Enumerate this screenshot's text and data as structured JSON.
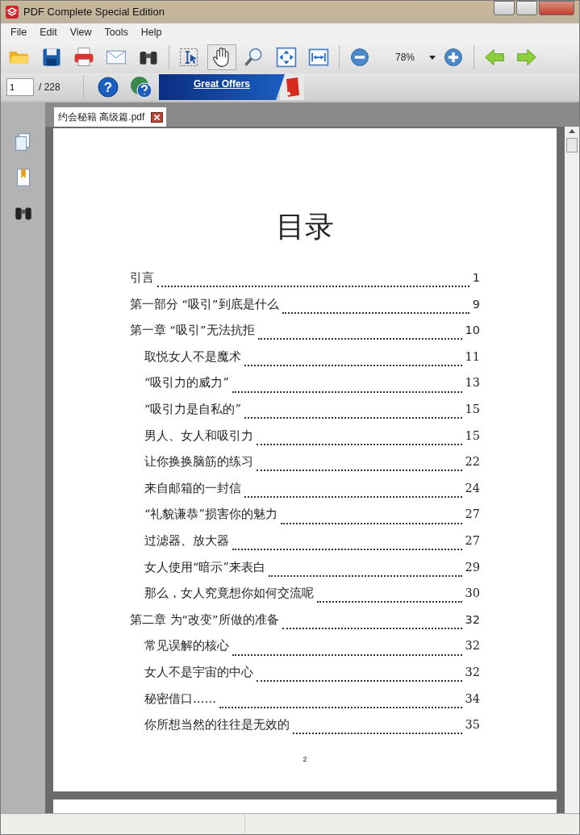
{
  "window": {
    "title": "PDF Complete Special Edition"
  },
  "menu": [
    "File",
    "Edit",
    "View",
    "Tools",
    "Help"
  ],
  "toolbar": [
    {
      "kind": "open",
      "selected": false
    },
    {
      "kind": "save",
      "selected": false
    },
    {
      "kind": "print",
      "selected": false
    },
    {
      "kind": "email",
      "selected": false
    },
    {
      "kind": "find",
      "selected": false
    },
    {
      "kind": "sep"
    },
    {
      "kind": "select",
      "selected": false
    },
    {
      "kind": "hand",
      "selected": true
    },
    {
      "kind": "magnify",
      "selected": false
    },
    {
      "kind": "fitpage",
      "selected": false
    },
    {
      "kind": "fitwidth",
      "selected": false
    },
    {
      "kind": "sep"
    },
    {
      "kind": "zoomout",
      "selected": false
    },
    {
      "kind": "zoom",
      "value": "78%"
    },
    {
      "kind": "zoomin",
      "selected": false
    },
    {
      "kind": "sep"
    },
    {
      "kind": "back",
      "selected": false
    },
    {
      "kind": "forward",
      "selected": false
    }
  ],
  "page_nav": {
    "value": "1",
    "total": "/ 228"
  },
  "help": {
    "glyph": "?"
  },
  "banner": {
    "text": "Great Offers"
  },
  "sidebar": [
    {
      "kind": "pages"
    },
    {
      "kind": "bookmarks"
    },
    {
      "kind": "search"
    }
  ],
  "tabs": [
    {
      "label": "约会秘籍 高级篇.pdf",
      "selected": true
    }
  ],
  "document": {
    "title": "目录",
    "page_number": "2",
    "toc": [
      {
        "kind": "chapter",
        "text": "引言",
        "page": "1"
      },
      {
        "kind": "chapter",
        "text": "第一部分 “吸引”到底是什么",
        "page": "9"
      },
      {
        "kind": "chapter",
        "text": "第一章 “吸引”无法抗拒",
        "page": "10"
      },
      {
        "kind": "section",
        "text": "取悦女人不是魔术",
        "page": "11"
      },
      {
        "kind": "section",
        "text": "“吸引力的威力”",
        "page": "13"
      },
      {
        "kind": "section",
        "text": "“吸引力是自私的”",
        "page": "15"
      },
      {
        "kind": "section",
        "text": "男人、女人和吸引力",
        "page": "15"
      },
      {
        "kind": "section",
        "text": "让你换换脑筋的练习",
        "page": "22"
      },
      {
        "kind": "section",
        "text": "来自邮箱的一封信",
        "page": "24"
      },
      {
        "kind": "section",
        "text": "“礼貌谦恭”损害你的魅力",
        "page": "27"
      },
      {
        "kind": "section",
        "text": "过滤器、放大器",
        "page": "27"
      },
      {
        "kind": "section",
        "text": "女人使用“暗示”来表白",
        "page": "29"
      },
      {
        "kind": "section",
        "text": "那么，女人究竟想你如何交流呢",
        "page": "30"
      },
      {
        "kind": "chapter",
        "text": "第二章 为“改变”所做的准备",
        "page": "32"
      },
      {
        "kind": "section",
        "text": "常见误解的核心",
        "page": "32"
      },
      {
        "kind": "section",
        "text": "女人不是宇宙的中心",
        "page": "32"
      },
      {
        "kind": "section",
        "text": "秘密借口……",
        "page": "34"
      },
      {
        "kind": "section",
        "text": "你所想当然的往往是无效的",
        "page": "35"
      }
    ]
  }
}
